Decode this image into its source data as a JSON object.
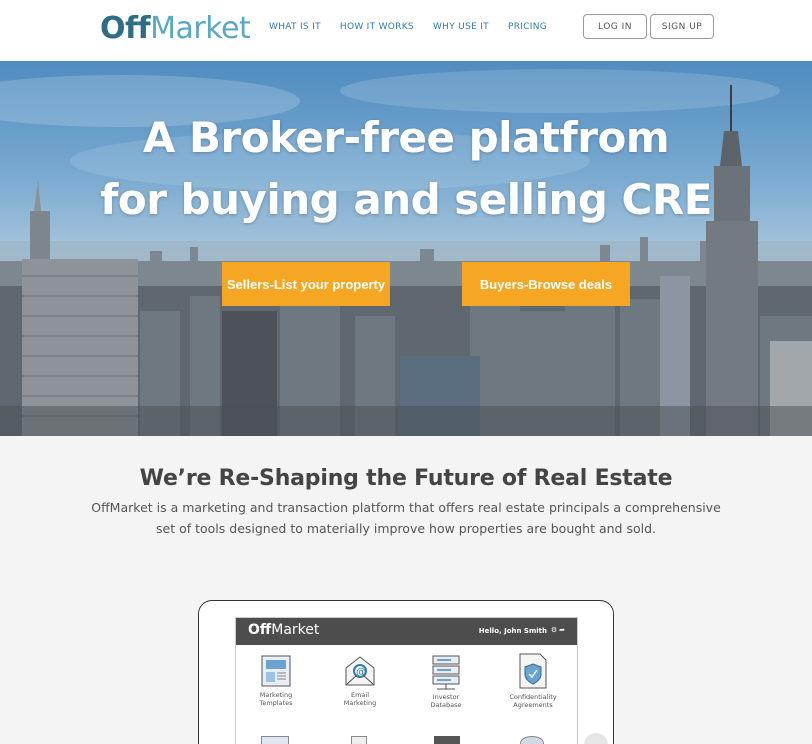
{
  "brand": {
    "logo_bold": "Off",
    "logo_light": "Market",
    "color_dark": "#2f6c86",
    "color_light": "#5aa8c4"
  },
  "nav": {
    "items": [
      "WHAT IS IT",
      "HOW IT WORKS",
      "WHY USE IT",
      "PRICING"
    ],
    "login": "LOG IN",
    "signup": "SIGN UP"
  },
  "hero": {
    "title_line1": "A Broker-free platfrom",
    "title_line2": "for buying and selling CRE",
    "sellers_cta": "Sellers-List your property",
    "buyers_cta": "Buyers-Browse deals",
    "cta_color": "#f5a623"
  },
  "intro": {
    "title": "We’re Re-Shaping the Future of Real Estate",
    "text": "OffMarket is a marketing and transaction platform that offers real estate principals a comprehensive set of tools designed to materially improve how properties are bought and sold."
  },
  "mockup": {
    "logo_bold": "Off",
    "logo_light": "Market",
    "greeting": "Hello, John Smith",
    "features": [
      {
        "label": "Marketing\nTemplates",
        "icon": "template-icon"
      },
      {
        "label": "Email\nMarketing",
        "icon": "email-icon"
      },
      {
        "label": "Investor\nDatabase",
        "icon": "database-icon"
      },
      {
        "label": "Confidentiality\nAgreements",
        "icon": "shield-document-icon"
      }
    ]
  }
}
